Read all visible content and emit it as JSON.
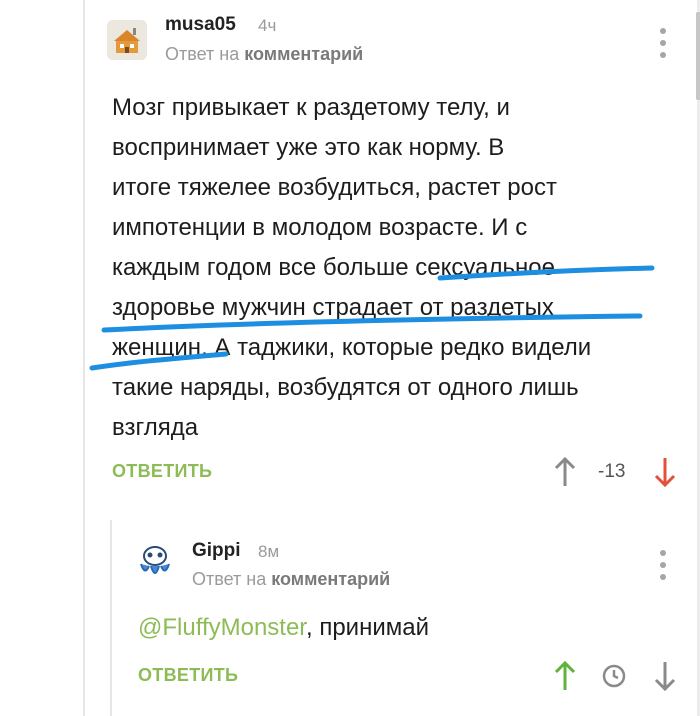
{
  "comments": [
    {
      "username": "musa05",
      "time": "4ч",
      "reply_prefix": "Ответ на",
      "reply_target": "комментарий",
      "body_lines": [
        "Мозг привыкает к раздетому телу, и",
        "воспринимает уже это как норму. В",
        "итоге тяжелее возбудиться, растет рост",
        "импотенции в молодом возрасте. И с",
        "каждым годом все больше сексуальное",
        "здоровье мужчин страдает от раздетых",
        "женщин. А таджики, которые редко видели",
        "такие наряды, возбудятся от одного лишь",
        "взгляда"
      ],
      "reply_label": "ОТВЕТИТЬ",
      "rating": "-13",
      "icons": {
        "upvote": "arrow-up-icon",
        "downvote": "arrow-down-icon",
        "menu": "more-vertical-icon"
      }
    },
    {
      "username": "Gippi",
      "time": "8м",
      "reply_prefix": "Ответ на",
      "reply_target": "комментарий",
      "mention": "@FluffyMonster",
      "body_rest": ", принимай",
      "reply_label": "ОТВЕТИТЬ",
      "icons": {
        "upvote": "arrow-up-icon",
        "clock": "clock-icon",
        "downvote": "arrow-down-icon",
        "menu": "more-vertical-icon"
      }
    }
  ],
  "colors": {
    "accent_green": "#8dbc56",
    "downvote_red": "#e2523a",
    "muted_text": "#9a9a9a",
    "underline_blue": "#1e8fe0"
  }
}
